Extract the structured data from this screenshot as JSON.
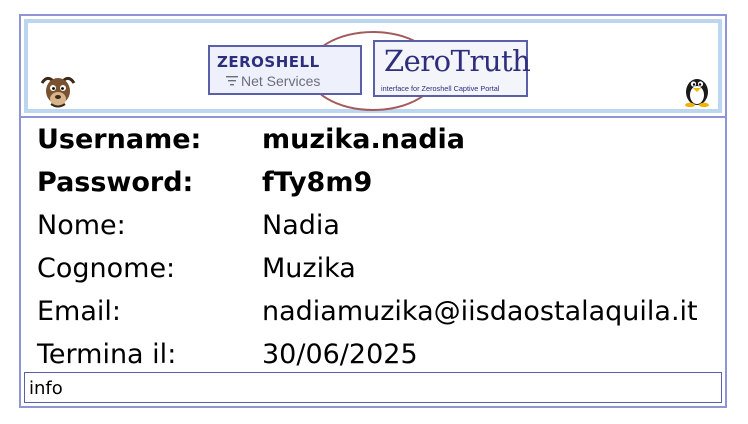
{
  "header": {
    "logo_zeroshell_title": "ZEROSHELL",
    "logo_zeroshell_sub": "Net Services",
    "logo_zerotruth_title": "ZeroTruth",
    "logo_zerotruth_sub": "interface for Zeroshell Captive Portal"
  },
  "user": {
    "rows": [
      {
        "label": "Username:",
        "value": "muzika.nadia"
      },
      {
        "label": "Password:",
        "value": "fTy8m9"
      },
      {
        "label": "Nome:",
        "value": "Nadia"
      },
      {
        "label": "Cognome:",
        "value": "Muzika"
      },
      {
        "label": "Email:",
        "value": "nadiamuzika@iisdaostalaquila.it"
      },
      {
        "label": "Termina il:",
        "value": "30/06/2025"
      }
    ]
  },
  "footer": {
    "info_label": "info"
  },
  "colors": {
    "border": "#8f94d6",
    "banner_border": "#bcd6ef",
    "logo_blue": "#2d2f7d",
    "ellipse": "#a35a5a"
  },
  "icons": {
    "left_mascot": "gnu-mascot-icon",
    "right_mascot": "tux-penguin-icon"
  }
}
